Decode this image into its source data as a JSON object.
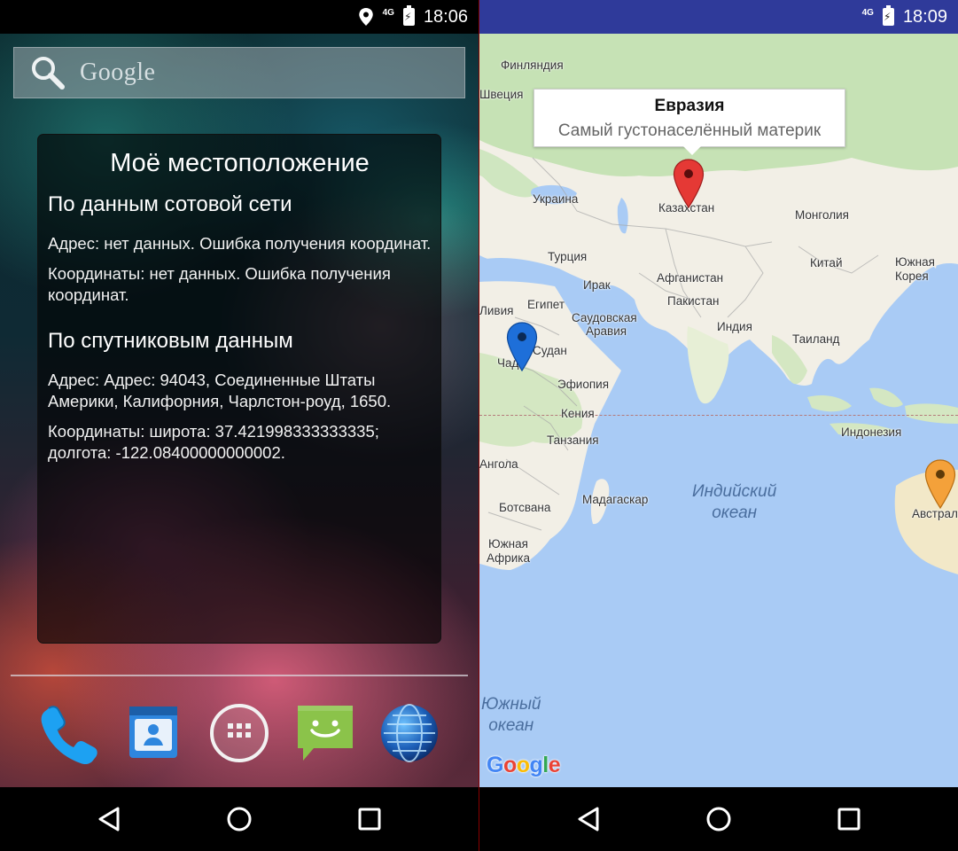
{
  "left_screen": {
    "status_bar": {
      "time": "18:06",
      "network": "4G"
    },
    "search_bar": {
      "text": "Google"
    },
    "widget": {
      "title": "Моё местоположение",
      "cell_section": {
        "heading": "По данным сотовой сети",
        "address": "Адрес: нет данных. Ошибка получения координат.",
        "coordinates": "Координаты: нет данных. Ошибка получения координат."
      },
      "gps_section": {
        "heading": "По спутниковым данным",
        "address": "Адрес: Адрес: 94043, Соединенные Штаты Америки, Калифорния, Чарлстон-роуд, 1650.",
        "coordinates": "Координаты: широта: 37.421998333333335; долгота: -122.08400000000002."
      }
    },
    "dock": [
      "phone-icon",
      "contacts-icon",
      "app-drawer-icon",
      "messaging-icon",
      "browser-icon"
    ]
  },
  "right_screen": {
    "status_bar": {
      "time": "18:09",
      "network": "4G"
    },
    "info_window": {
      "title": "Евразия",
      "snippet": "Самый густонаселённый материк"
    },
    "labels": {
      "finland": "Финляндия",
      "sweden": "Швеция",
      "ukraine": "Украина",
      "kazakhstan": "Казахстан",
      "mongolia": "Монголия",
      "turkey": "Турция",
      "china": "Китай",
      "south_korea_1": "Южная",
      "south_korea_2": "Корея",
      "iraq": "Ирак",
      "afghanistan": "Афганистан",
      "libya": "Ливия",
      "egypt": "Египет",
      "pakistan": "Пакистан",
      "saudi_1": "Саудовская",
      "saudi_2": "Аравия",
      "india": "Индия",
      "thailand": "Таиланд",
      "chad": "Чад",
      "sudan": "Судан",
      "ethiopia": "Эфиопия",
      "kenya": "Кения",
      "indonesia": "Индонезия",
      "tanzania": "Танзания",
      "angola": "Ангола",
      "madagascar": "Мадагаскар",
      "botswana": "Ботсвана",
      "south_africa_1": "Южная",
      "south_africa_2": "Африка",
      "australia": "Австрал"
    },
    "ocean_labels": {
      "indian_1": "Индийский",
      "indian_2": "океан",
      "southern_1": "Южный",
      "southern_2": "океан"
    },
    "google_logo": "Google",
    "markers": {
      "eurasia_color": "#e53935",
      "africa_color": "#1e6fd9",
      "australia_color": "#f4a13a"
    }
  }
}
